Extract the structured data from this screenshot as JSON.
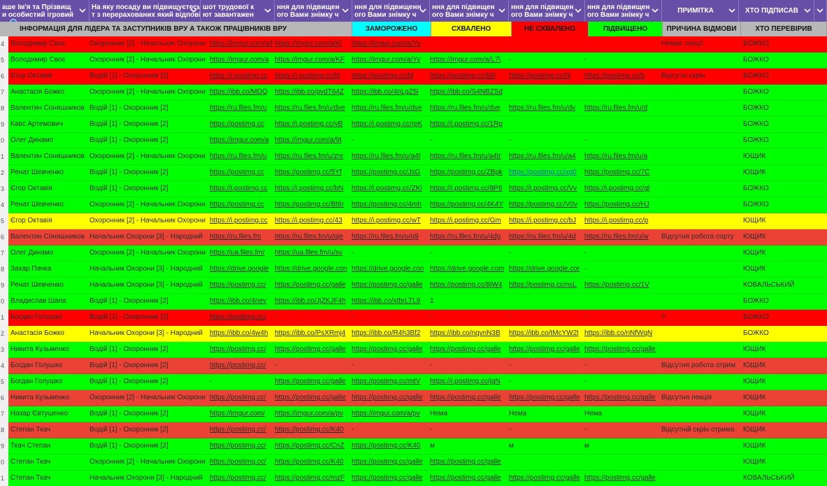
{
  "colors": {
    "green": "#00ff00",
    "red_bright": "#ff0000",
    "red_soft": "#ea4335",
    "yellow": "#ffff00",
    "header_purple": "#674ea7",
    "header_grey": "#b7b7b7",
    "cyan": "#00ffff"
  },
  "header_top": [
    {
      "text": "аше Ім'я та Прізвищ\nи особистий ігровий",
      "filter": true
    },
    {
      "text": "На яку посаду ви підвищуєтесь?\nт з перерахованих який відповід",
      "filter": true
    },
    {
      "text": "шот трудової к\nют завантажен",
      "filter": true
    },
    {
      "text": "ння для підвищен\nого Вами знімку ч",
      "filter": true
    },
    {
      "text": "ння для підвищенн\nого Вами знімку ч",
      "filter": true
    },
    {
      "text": "ння для підвищен\nого Вами знімку ч",
      "filter": true
    },
    {
      "text": "ння для підвищен\nого Вами знімку ч",
      "filter": true
    },
    {
      "text": "ння для підвищен\nого Вами знімку ч",
      "filter": true
    },
    {
      "text": "ПРИМІТКА",
      "filter": true
    },
    {
      "text": "ХТО ПІДПИСАВ",
      "filter": true
    },
    {
      "text": "",
      "filter": false
    }
  ],
  "header_sub": [
    {
      "text": "ІНФОРМАЦІЯ   ДЛЯ   ЛІДЕРА   ТА   ЗАСТУПНИКІВ   ВРУ    А   ТАКОЖ    ПРАЦІВНИКІВ   ВРУ",
      "bg": "#b7b7b7"
    },
    {
      "text": "ЗАМОРОЖЕНО",
      "bg": "#00ffff"
    },
    {
      "text": "СХВАЛЕНО",
      "bg": "#ffff00"
    },
    {
      "text": "НЕ СХВАЛЕНО",
      "bg": "#ff0000"
    },
    {
      "text": "ПІДВИЩЕНО",
      "bg": "#00ff00"
    },
    {
      "text": "ПРИЧИНА ВІДМОВИ",
      "bg": "#b7b7b7"
    },
    {
      "text": "ХТО ПЕРЕВІРИВ",
      "bg": "#b7b7b7"
    }
  ],
  "rows": [
    {
      "n": "4",
      "bg": "#ff0000",
      "name": "Володимир Своє",
      "pos": "Охоронник [2] - Начальник Охорони",
      "l1": "https://imgur.com/a/Kl",
      "l2": "https://imgur.com/a/Kl",
      "l3": "https://imgur.com/a/Yv",
      "l4": "",
      "l5": "",
      "l6": "",
      "note": "Немає лекції",
      "who": "БОЖКО"
    },
    {
      "n": "5",
      "bg": "#00ff00",
      "name": "Володимир Своє",
      "pos": "Охоронник [2] - Начальник Охорони",
      "l1": "https://imgur.com/a",
      "l2": "https://imgur.com/a/KF",
      "l3": "https://imgur.com/a/Yv",
      "l4": "https://imgur.com/a/L7\\",
      "l5": "-",
      "l6": "-",
      "note": "",
      "who": "БОЖКО"
    },
    {
      "n": "6",
      "bg": "#ff0000",
      "name": "Єгор Октавія",
      "pos": "Водій [1] - Охоронник [2]",
      "l1": "https://i.postimg.cc",
      "l2": "https://i.postimg.cc/hl",
      "l3": "https://postimg.cc/bl",
      "l4": "https://postimg.cc/bl0",
      "l5": "https://postimg.cc/hl",
      "l6": "https://postimg.cc/b",
      "note": "Відсутні скрін",
      "who": "БОЖКО"
    },
    {
      "n": "7",
      "bg": "#00ff00",
      "name": "Анастасія Божко",
      "pos": "Охоронник [2] - Начальник Охорони",
      "l1": "https://ibb.co/MDQ",
      "l2": "https://ibb.co/pvdT64Z",
      "l3": "https://ibb.co/4nLgZ5l",
      "l4": "https://ibb.co/S4NBZSd",
      "l5": "",
      "l6": "",
      "note": "",
      "who": "БОЖКО"
    },
    {
      "n": "8",
      "bg": "#00ff00",
      "name": "Валентин Соняшников",
      "pos": "Водій [1] - Охоронник [2]",
      "l1": "https://ru.files.fm/u",
      "l2": "https://ru.files.fm/u/dve",
      "l3": "https://ru.files.fm/u/dve",
      "l4": "https://ru.files.fm/u/dve",
      "l5": "https://ru.files.fm/u/dv",
      "l6": "https://ru.files.fm/u/d",
      "note": "",
      "who": "БОЖКО"
    },
    {
      "n": "9",
      "bg": "#00ff00",
      "name": "Кавс Артемович",
      "pos": "Водій [1] - Охоронник [2]",
      "l1": "https://postimg.cc",
      "l2": "https://i.postimg.cc/vB",
      "l3": "https://i.postimg.cc/rpK",
      "l4": "https://i.postimg.cc/1Rp",
      "l5": "",
      "l6": "",
      "note": "",
      "who": "БОЖКО"
    },
    {
      "n": "0",
      "bg": "#00ff00",
      "name": "Олег Динамо",
      "pos": "Водій [1] - Охоронник [2]",
      "l1": "https://imgur.com/a",
      "l2": "https://imgur.com/a/9t",
      "l3": "-",
      "l4": "-",
      "l5": "-",
      "l6": "-",
      "note": "",
      "who": "БОЖКО"
    },
    {
      "n": "1",
      "bg": "#00ff00",
      "name": "Валентин Соняшников",
      "pos": "Охоронник [2] - Начальник Охорони",
      "l1": "https://ru.files.fm/u",
      "l2": "https://ru.files.fm/u/znr",
      "l3": "https://ru.files.fm/u/a4t",
      "l4": "https://ru.files.fm/u/a4tr",
      "l5": "https://ru.files.fm/u/a4",
      "l6": "https://ru.files.fm/u/a",
      "note": "",
      "who": "ЮЩИК"
    },
    {
      "n": "2",
      "bg": "#00ff00",
      "name": "Ренат Шевченко",
      "pos": "Водій [1] - Охоронник [2]",
      "l1": "https://postimg.cc",
      "l2": "https://postimg.cc/5Yf",
      "l3": "https://postimg.cc/JsG",
      "l4": "https://postimg.cc/ZBpk",
      "l5": "https://postimg.cc/xg0",
      "l6": "https://postimg.cc/7C",
      "note": "",
      "who": "ЮЩИК"
    },
    {
      "n": "3",
      "bg": "#00ff00",
      "name": "Єгор Октавія",
      "pos": "Водій [1] - Охоронник [2]",
      "l1": "https://i.postimg.cc",
      "l2": "https://i.postimg.cc/bN",
      "l3": "https://i.postimg.cc/ZKl",
      "l4": "https://i.postimg.cc/8P6",
      "l5": "https://i.postimg.cc/Vv",
      "l6": "https://i.postimg.cc/gl",
      "note": "",
      "who": "БОЖКО"
    },
    {
      "n": "4",
      "bg": "#00ff00",
      "name": "Ренат Шевченко",
      "pos": "Охоронник [2] - Начальник Охорони",
      "l1": "https://postimg.cc",
      "l2": "https://postimg.cc/Bt6r",
      "l3": "https://postimg.cc/4mh",
      "l4": "https://postimg.cc/4K4Y",
      "l5": "https://postimg.cc/V0v",
      "l6": "https://postimg.cc/HJ",
      "note": "",
      "who": "БОЖКО"
    },
    {
      "n": "5",
      "bg": "#ffff00",
      "name": "Єгор Октавія",
      "pos": "Охоронник [2] - Начальник Охорони",
      "l1": "https://i.postimg.cc",
      "l2": "https://i.postimg.cc/43",
      "l3": "https://i.postimg.cc/wT",
      "l4": "https://i.postimg.cc/Gm",
      "l5": "https://i.postimg.cc/bJ",
      "l6": "https://i.postimg.cc/p",
      "note": "",
      "who": "ЮЩИК"
    },
    {
      "n": "6",
      "bg": "#ea4335",
      "name": "Валентин Соняшников",
      "pos": "Начальник Охорони [3] - Народний",
      "l1": "https://ru.files.fm",
      "l2": "https://ru.files.fm/u/qje",
      "l3": "https://ru.files.fm/u/q9",
      "l4": "https://ru.files.fm/u/4dg",
      "l5": "https://ru.files.fm/u/4d",
      "l6": "https://ru.files.fm/u/w",
      "note": "Відсутня робота сорту",
      "who": "ЮЩИК"
    },
    {
      "n": "7",
      "bg": "#00ff00",
      "name": "Олег Динамо",
      "pos": "Охоронник [2] - Начальник Охорони",
      "l1": "https://ua.files.fm/",
      "l2": "https://ua.files.fm/u/sv",
      "l3": "-",
      "l4": "-",
      "l5": "-",
      "l6": "-",
      "note": "",
      "who": "ЮЩИК"
    },
    {
      "n": "8",
      "bg": "#00ff00",
      "name": "Захар Пачка",
      "pos": "Начальник Охорони [3] - Народний",
      "l1": "https://drive.google",
      "l2": "https://drive.google.con",
      "l3": "https://drive.google.con",
      "l4": "https://drive.google.com",
      "l5": "https://drive.google.cor",
      "l6": "-",
      "note": "",
      "who": "ЮЩИК"
    },
    {
      "n": "9",
      "bg": "#00ff00",
      "name": "Ренат Шевченко",
      "pos": "Начальник Охорони [3] - Народний",
      "l1": "https://postimg.cc/",
      "l2": "https://postimg.cc/galle",
      "l3": "https://postimg.cc/galle",
      "l4": "https://postimg.cc/8jW4",
      "l5": "https://postimg.cc/nsL",
      "l6": "https://postimg.cc/1V",
      "note": "",
      "who": "КОВАЛЬСЬКИЙ"
    },
    {
      "n": "0",
      "bg": "#00ff00",
      "name": "Владислав Шапа",
      "pos": "Водій [1] - Охоронник [2]",
      "l1": "https://ibb.co/4nev",
      "l2": "https://ibb.co/JjZKJF4h",
      "l3": "https://ibb.co/xtbrLTL9",
      "l4": "1",
      "l5": "",
      "l6": "",
      "note": "",
      "who": "БОЖКО"
    },
    {
      "n": "1",
      "bg": "#ff0000",
      "name": "Богдан Голушко",
      "pos": "Водій [1] - Охоронник [2]",
      "l1": "https://postimg.cc/",
      "l2": "-",
      "l3": "-",
      "l4": "-",
      "l5": "-",
      "l6": "-",
      "note": "?",
      "who": "БОЖКО"
    },
    {
      "n": "2",
      "bg": "#ffff00",
      "name": "Анастасія Божко",
      "pos": "Начальник Охорони [3] - Народний",
      "l1": "https://ibb.co/4w4h",
      "l2": "https://ibb.co/PsXRmj4",
      "l3": "https://ibb.co/R4h3Bf2",
      "l4": "https://ibb.co/nqvnN3B",
      "l5": "https://ibb.co/tMcYW2l",
      "l6": "https://ibb.co/nNfWqN",
      "note": "",
      "who": "БОЖКО"
    },
    {
      "n": "3",
      "bg": "#00ff00",
      "name": "Никита Кузьменко",
      "pos": "Водій [1] - Охоронник [2]",
      "l1": "https://postimg.cc/",
      "l2": "https://postimg.cc/galle",
      "l3": "https://postimg.cc/galle",
      "l4": "https://postimg.cc/galle",
      "l5": "https://postimg.cc/galle",
      "l6": "https://postimg.cc/galle",
      "note": "",
      "who": "ЮЩИК"
    },
    {
      "n": "4",
      "bg": "#ea4335",
      "name": "Богдан Голушко",
      "pos": "Водій [1] - Охоронник [2]",
      "l1": "https://postimg.cc/",
      "l2": "-",
      "l3": "-",
      "l4": "-",
      "l5": "-",
      "l6": "-",
      "note": "Відсутня робота отрим",
      "who": "ЮЩИК"
    },
    {
      "n": "5",
      "bg": "#00ff00",
      "name": "Богдан Голушко",
      "pos": "Водій [1] - Охоронник [2]",
      "l1": "-",
      "l2": "https://postimg.cc/galle",
      "l3": "https://postimg.cc/mtV",
      "l4": "https://i.postimg.cc/jqN",
      "l5": "-",
      "l6": "-",
      "note": "",
      "who": "ЮЩИК"
    },
    {
      "n": "6",
      "bg": "#ea4335",
      "name": "Никита Кузьменко",
      "pos": "Охоронник [2] - Начальник Охорони",
      "l1": "https://postimg.cc/",
      "l2": "https://postimg.cc/galle",
      "l3": "https://postimg.cc/galle",
      "l4": "https://postimg.cc/galle",
      "l5": "https://postimg.cc/galle",
      "l6": "https://postimg.cc/galle",
      "note": "Відсутня лекція",
      "who": "ЮЩИК"
    },
    {
      "n": "7",
      "bg": "#00ff00",
      "name": "Назар Євтушенко",
      "pos": "Водій [1] - Охоронник [2]",
      "l1": "https://imgur.com/",
      "l2": "https://imgur.com/a/pv",
      "l3": "https://imgur.com/a/pv",
      "l4": "Нема",
      "l5": "Нема",
      "l6": "Нема",
      "note": "",
      "who": "ЮЩИК"
    },
    {
      "n": "8",
      "bg": "#ea4335",
      "name": "Степан Ткач",
      "pos": "Водій [1] - Охоронник [2]",
      "l1": "https://postimg.cc/",
      "l2": "https://postimg.cc/K40",
      "l3": "-",
      "l4": "-",
      "l5": "-",
      "l6": "-",
      "note": "Відсутній скрін отрима",
      "who": "ЮЩИК"
    },
    {
      "n": "9",
      "bg": "#00ff00",
      "name": "Ткач Степан",
      "pos": "Водій [1] - Охоронник [2]",
      "l1": "https://postimg.cc/",
      "l2": "https://postimg.cc/CnZ",
      "l3": "https://postimg.cc/K40",
      "l4": "м",
      "l5": "м",
      "l6": "м",
      "note": "",
      "who": "ЮЩИК"
    },
    {
      "n": "0",
      "bg": "#00ff00",
      "name": "Степан Ткач",
      "pos": "Охоронник [2] - Начальник Охорони",
      "l1": "https://postimg.cc/",
      "l2": "https://postimg.cc/K40",
      "l3": "https://postimg.cc/galle",
      "l4": "https://postimg.cc/galle",
      "l5": "",
      "l6": "",
      "note": "",
      "who": "ЮЩИК"
    },
    {
      "n": "1",
      "bg": "#00ff00",
      "name": "Степан Ткач",
      "pos": "Начальник Охорони [3] - Народний",
      "l1": "https://postimg.cc/",
      "l2": "https://postimg.cc/mzF",
      "l3": "https://postimg.cc/galle",
      "l4": "https://postimg.cc/galle",
      "l5": "https://postimg.cc/galle",
      "l6": "https://postimg.cc/galle",
      "note": "",
      "who": "КОВАЛЬСЬКИЙ"
    }
  ]
}
